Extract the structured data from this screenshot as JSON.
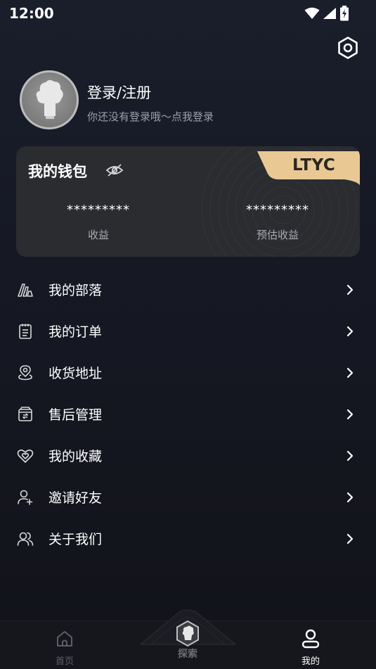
{
  "status_bar": {
    "time": "12:00",
    "icons": [
      "wifi-icon",
      "signal-icon",
      "battery-charging-icon"
    ]
  },
  "header": {
    "settings_icon": "settings-gear-icon"
  },
  "profile": {
    "title": "登录/注册",
    "subtitle": "你还没有登录哦～点我登录"
  },
  "wallet": {
    "title": "我的钱包",
    "brand_tab": "LTYC",
    "earnings": {
      "value": "*********",
      "label": "收益"
    },
    "estimated": {
      "value": "*********",
      "label": "预估收益"
    }
  },
  "menu": [
    {
      "label": "我的部落",
      "icon": "tribe-icon"
    },
    {
      "label": "我的订单",
      "icon": "order-list-icon"
    },
    {
      "label": "收货地址",
      "icon": "location-pin-icon"
    },
    {
      "label": "售后管理",
      "icon": "after-sales-box-icon"
    },
    {
      "label": "我的收藏",
      "icon": "heart-icon"
    },
    {
      "label": "邀请好友",
      "icon": "add-user-icon"
    },
    {
      "label": "关于我们",
      "icon": "users-icon"
    }
  ],
  "bottom_nav": {
    "home": "首页",
    "explore": "探索",
    "mine": "我的"
  },
  "colors": {
    "active_tab": "#ffffff",
    "inactive_tab": "#5c5f67",
    "brand_gold": "#e9c894"
  }
}
